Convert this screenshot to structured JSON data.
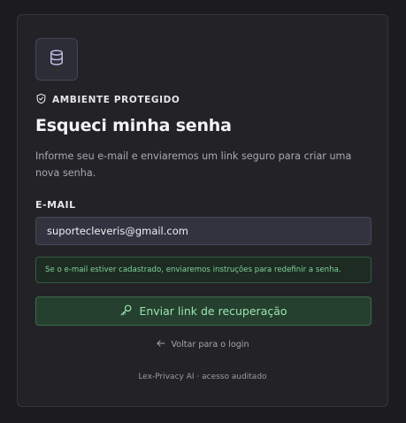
{
  "brand": {
    "logo_icon": "database-icon"
  },
  "badge": {
    "icon": "shield-check-icon",
    "label": "AMBIENTE PROTEGIDO"
  },
  "page": {
    "title": "Esqueci minha senha",
    "description": "Informe seu e-mail e enviaremos um link seguro para criar uma nova senha."
  },
  "form": {
    "email_label": "E-MAIL",
    "email_value": "suportecleveris@gmail.com",
    "notice": "Se o e-mail estiver cadastrado, enviaremos instruções para redefinir a senha.",
    "submit_icon": "key-icon",
    "submit_label": "Enviar link de recuperação"
  },
  "back": {
    "icon": "arrow-left-icon",
    "label": "Voltar para o login"
  },
  "footer": {
    "text": "Lex-Privacy AI · acesso auditado"
  },
  "colors": {
    "background": "#1c1c1f",
    "card": "#232327",
    "accent_green": "#9be3b0",
    "notice_text": "#7fd39a",
    "logo_icon": "#b8bde0"
  }
}
